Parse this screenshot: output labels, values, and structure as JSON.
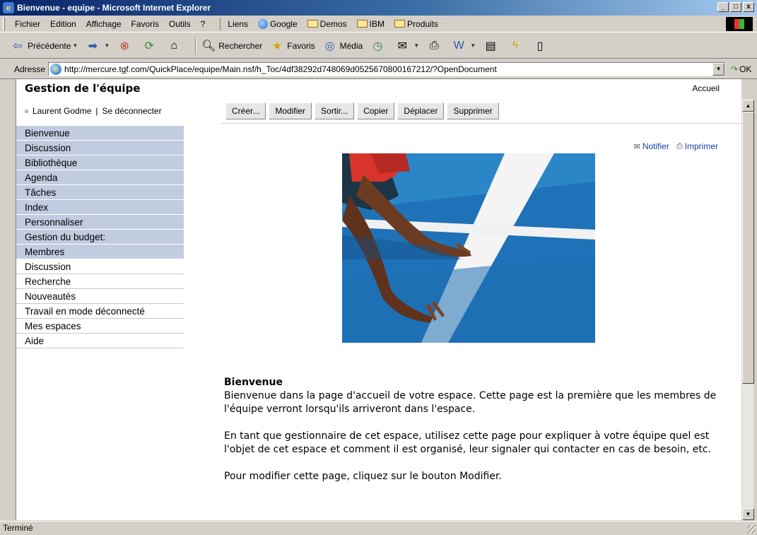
{
  "window": {
    "title": "Bienvenue - equipe - Microsoft Internet Explorer",
    "controls": [
      "_",
      "□",
      "x"
    ]
  },
  "menubar": {
    "items": [
      "Fichier",
      "Edition",
      "Affichage",
      "Favoris",
      "Outils",
      "?"
    ],
    "links_label": "Liens",
    "links": [
      "Google",
      "Demos",
      "IBM",
      "Produits"
    ]
  },
  "toolbar": {
    "back_label": "Précédente",
    "search_label": "Rechercher",
    "favorites_label": "Favoris",
    "media_label": "Média"
  },
  "addressbar": {
    "label": "Adresse",
    "url": "http://mercure.tgf.com/QuickPlace/equipe/Main.nsf/h_Toc/4df38292d748069d0525670800167212/?OpenDocument",
    "go_label": "OK"
  },
  "page": {
    "title": "Gestion de l'équipe",
    "home_link": "Accueil",
    "user_name": "Laurent Godme",
    "logout_label": "Se déconnecter",
    "actions": [
      "Créer...",
      "Modifier",
      "Sortir...",
      "Copier",
      "Déplacer",
      "Supprimer"
    ],
    "nav_shaded": [
      "Bienvenue",
      "Discussion",
      "Bibliothèque",
      "Agenda",
      "Tâches",
      "Index",
      "Personnaliser",
      "Gestion du budget:",
      "Membres"
    ],
    "nav_plain": [
      "Discussion",
      "Recherche",
      "Nouveautés",
      "Travail en mode déconnecté",
      "Mes espaces",
      "Aide"
    ],
    "notify_label": "Notifier",
    "print_label": "Imprimer",
    "content": {
      "heading": "Bienvenue",
      "p1": "Bienvenue dans la page d'accueil de votre espace. Cette page est la première que les membres de l'équipe verront lorsqu'ils arriveront dans l'espace.",
      "p2": "En tant que gestionnaire de cet espace, utilisez cette page pour expliquer à votre équipe quel est l'objet de cet espace et comment il est organisé, leur signaler qui contacter en cas de besoin, etc.",
      "p3": "Pour modifier cette page, cliquez sur le bouton Modifier."
    }
  },
  "statusbar": {
    "text": "Terminé"
  },
  "colors": {
    "nav_shaded": "#c2cce0",
    "title_bar": "#0a246a",
    "link": "#1a3ca6"
  }
}
